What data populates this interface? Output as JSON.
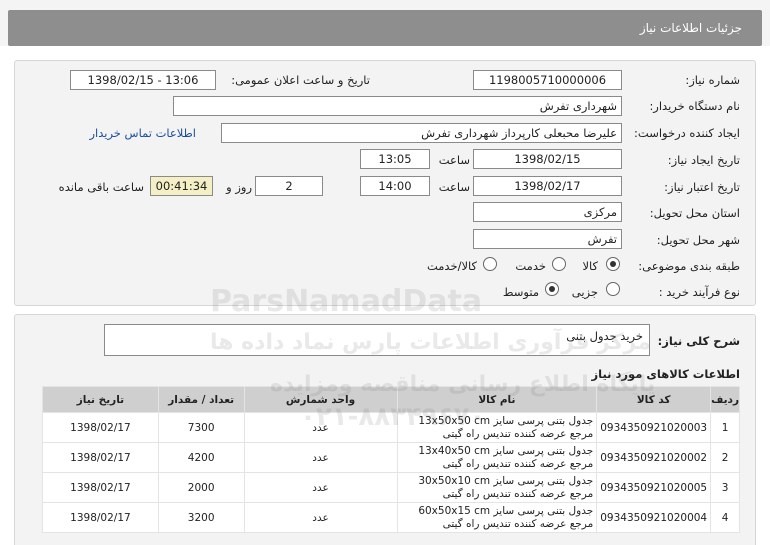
{
  "page": {
    "title": "جزئیات اطلاعات نیاز"
  },
  "form": {
    "need_number_label": "شماره نیاز:",
    "need_number": "1198005710000006",
    "announce_label": "تاریخ و ساعت اعلان عمومی:",
    "announce_value": "1398/02/15 - 13:06",
    "buyer_label": "نام دستگاه خریدار:",
    "buyer": "شهرداری تفرش",
    "requester_label": "ایجاد کننده درخواست:",
    "requester": "علیرضا محبعلی کارپرداز شهرداری تفرش",
    "contact_link": "اطلاعات تماس خریدار",
    "created_label": "تاریخ ایجاد نیاز:",
    "created_date": "1398/02/15",
    "time_label": "ساعت",
    "created_time": "13:05",
    "valid_label": "تاریخ اعتبار نیاز:",
    "valid_date": "1398/02/17",
    "valid_time": "14:00",
    "days": "2",
    "days_label": "روز و",
    "remaining": "00:41:34",
    "remaining_label": "ساعت باقی مانده",
    "province_label": "استان محل تحویل:",
    "province": "مرکزی",
    "city_label": "شهر محل تحویل:",
    "city": "تفرش",
    "category_label": "طبقه بندی موضوعی:",
    "category_options": [
      "کالا",
      "خدمت",
      "کالا/خدمت"
    ],
    "category_selected": "کالا",
    "process_label": "نوع فرآیند خرید :",
    "process_options": [
      "جزیی",
      "متوسط"
    ],
    "process_selected": "متوسط"
  },
  "summary": {
    "label": "شرح کلی نیاز:",
    "text": "خرید جدول بتنی"
  },
  "goods": {
    "title": "اطلاعات کالاهای مورد نیاز",
    "headers": [
      "ردیف",
      "کد کالا",
      "نام کالا",
      "واحد شمارش",
      "تعداد / مقدار",
      "تاریخ نیاز"
    ],
    "rows": [
      [
        "1",
        "0934350921020003",
        "جدول بتنی پرسی سایز 13x50x50 cm مرجع عرضه کننده تندیس راه گیتی",
        "عدد",
        "7300",
        "1398/02/17"
      ],
      [
        "2",
        "0934350921020002",
        "جدول بتنی پرسی سایز 13x40x50 cm مرجع عرضه کننده تندیس راه گیتی",
        "عدد",
        "4200",
        "1398/02/17"
      ],
      [
        "3",
        "0934350921020005",
        "جدول بتنی پرسی سایز 30x50x10 cm مرجع عرضه کننده تندیس راه گیتی",
        "عدد",
        "2000",
        "1398/02/17"
      ],
      [
        "4",
        "0934350921020004",
        "جدول بتنی پرسی سایز 60x50x15 cm مرجع عرضه کننده تندیس راه گیتی",
        "عدد",
        "3200",
        "1398/02/17"
      ]
    ]
  },
  "watermark": {
    "brand": "ParsNamadData",
    "line1": "مرکز فرآوری اطلاعات پارس نماد داده ها",
    "line2": "پایگاه اطلاع رسانی مناقصه ومزایده",
    "phone": "۰۲۱-۸۸۳۴۹۶۷۰"
  }
}
